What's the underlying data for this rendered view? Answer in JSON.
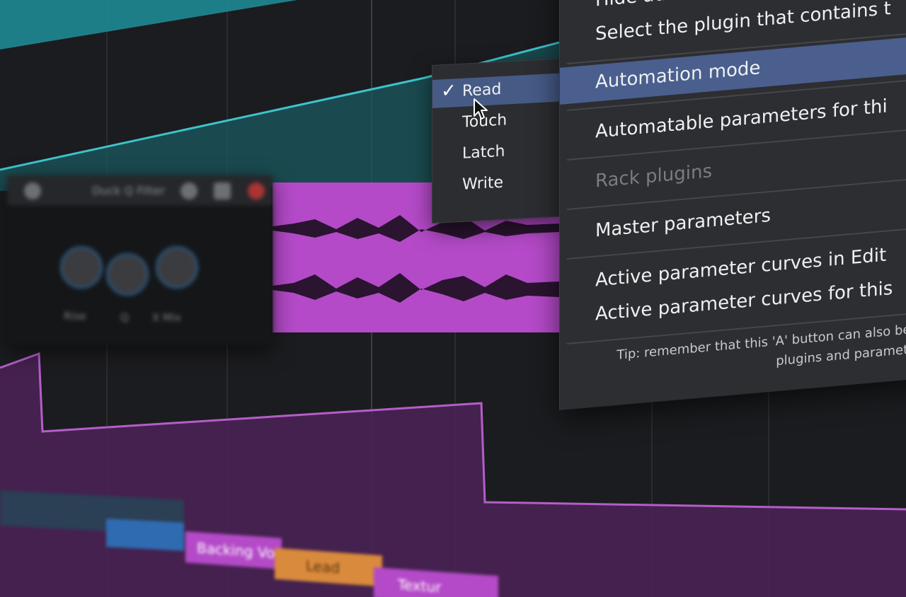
{
  "submenu": {
    "items": [
      {
        "label": "Read",
        "checked": true,
        "highlighted": true
      },
      {
        "label": "Touch",
        "checked": false,
        "highlighted": false
      },
      {
        "label": "Latch",
        "checked": false,
        "highlighted": false
      },
      {
        "label": "Write",
        "checked": false,
        "highlighted": false
      }
    ],
    "check_glyph": "✓"
  },
  "menu": {
    "items": [
      {
        "label": "Hide automati"
      },
      {
        "label": "Select the plugin that contains t"
      },
      {
        "label": "Automation mode",
        "highlighted": true
      },
      {
        "label": "Automatable parameters for thi"
      },
      {
        "label": "Rack plugins",
        "disabled": true
      },
      {
        "label": "Master parameters"
      },
      {
        "label": "Active parameter curves in Edit"
      },
      {
        "label": "Active parameter curves for this"
      }
    ],
    "tip_line1": "Tip: remember that this 'A' button can also be dr",
    "tip_line2": "plugins and parameters"
  },
  "plugin": {
    "title": "Duck Q Filter",
    "knob_labels": [
      "Rise",
      "Q",
      "X Mix"
    ]
  },
  "tracks": {
    "chips": [
      {
        "label": "Backing Vox",
        "color": "#b44ac8"
      },
      {
        "label": "Lead",
        "color": "#d98a3c"
      },
      {
        "label": "Textur",
        "color": "#b44ac8"
      }
    ]
  },
  "colors": {
    "teal": "#1f8a93",
    "purple_clip": "#b44ac8",
    "purple_auto": "#5a2a66",
    "menu_bg": "#2d2e31",
    "highlight": "#4a5f8e"
  }
}
